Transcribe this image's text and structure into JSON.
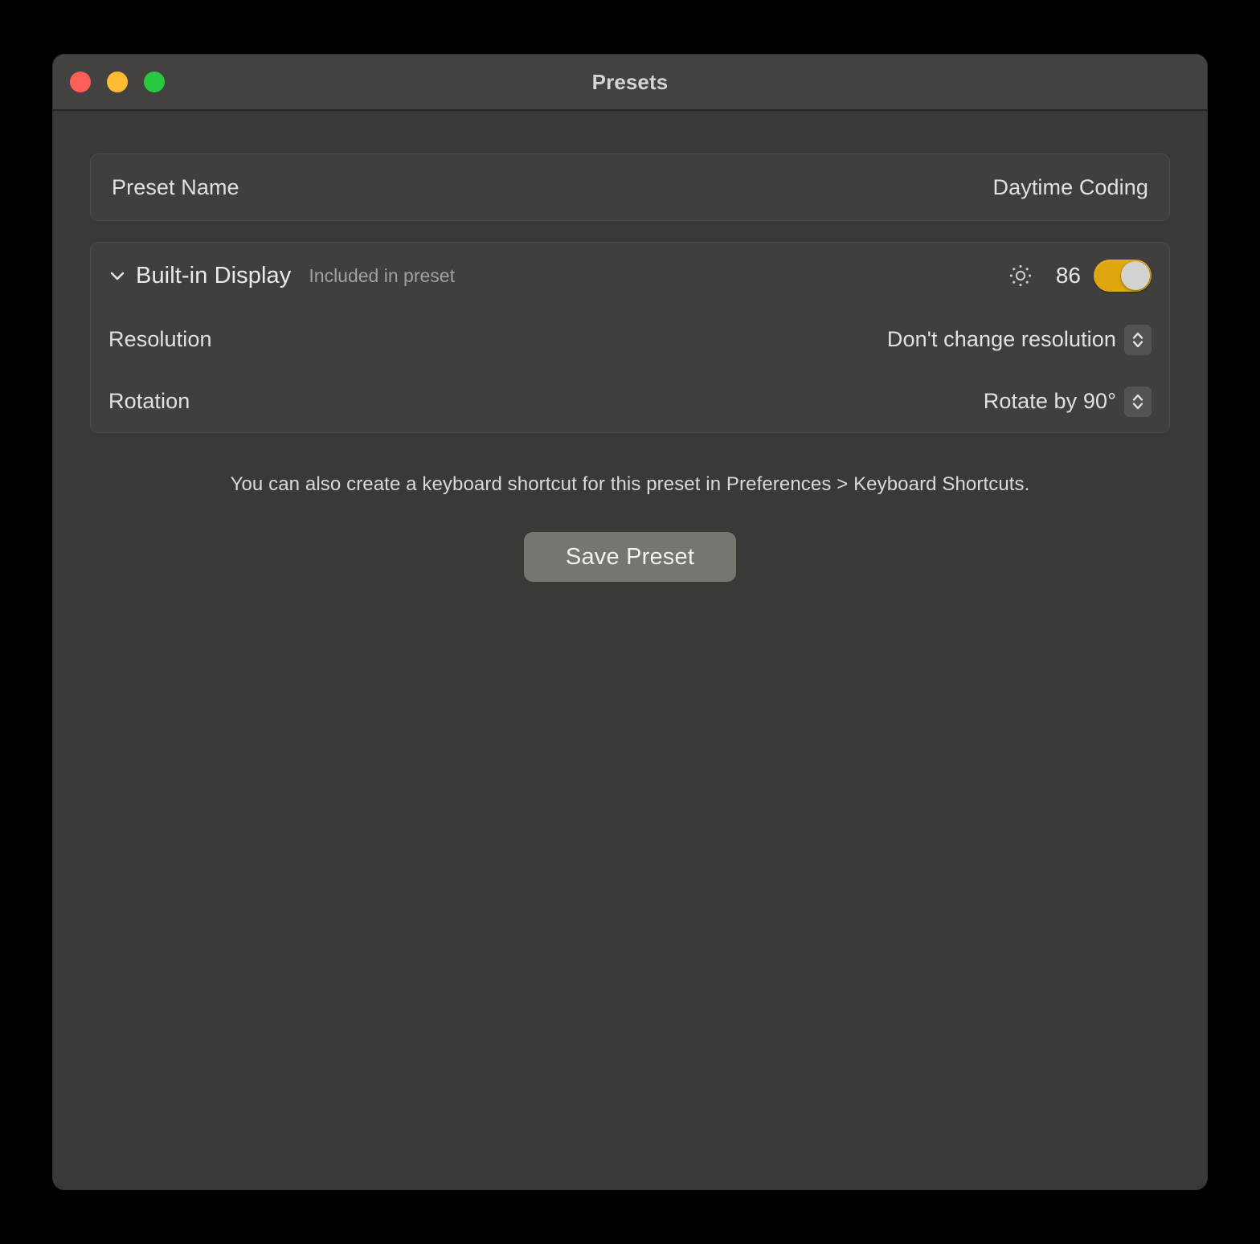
{
  "window": {
    "title": "Presets",
    "traffic_lights": [
      {
        "name": "close",
        "color": "#ff5f57"
      },
      {
        "name": "minimize",
        "color": "#febc2e"
      },
      {
        "name": "zoom",
        "color": "#28c840"
      }
    ]
  },
  "preset_name_row": {
    "label": "Preset Name",
    "value": "Daytime Coding"
  },
  "display_section": {
    "disclosure_icon": "chevron-down-icon",
    "title": "Built-in Display",
    "subtitle": "Included in preset",
    "brightness": {
      "icon": "brightness-sun-icon",
      "value": "86",
      "toggle_on": true,
      "toggle_color": "#e0a80e",
      "knob_color": "#d3d2cf"
    },
    "rows": [
      {
        "label": "Resolution",
        "value": "Don't change resolution",
        "control": "popup-button"
      },
      {
        "label": "Rotation",
        "value": "Rotate by 90°",
        "control": "popup-button"
      }
    ]
  },
  "footer": {
    "note": "You can also create a keyboard shortcut for this preset in Preferences > Keyboard Shortcuts.",
    "save_label": "Save Preset"
  }
}
